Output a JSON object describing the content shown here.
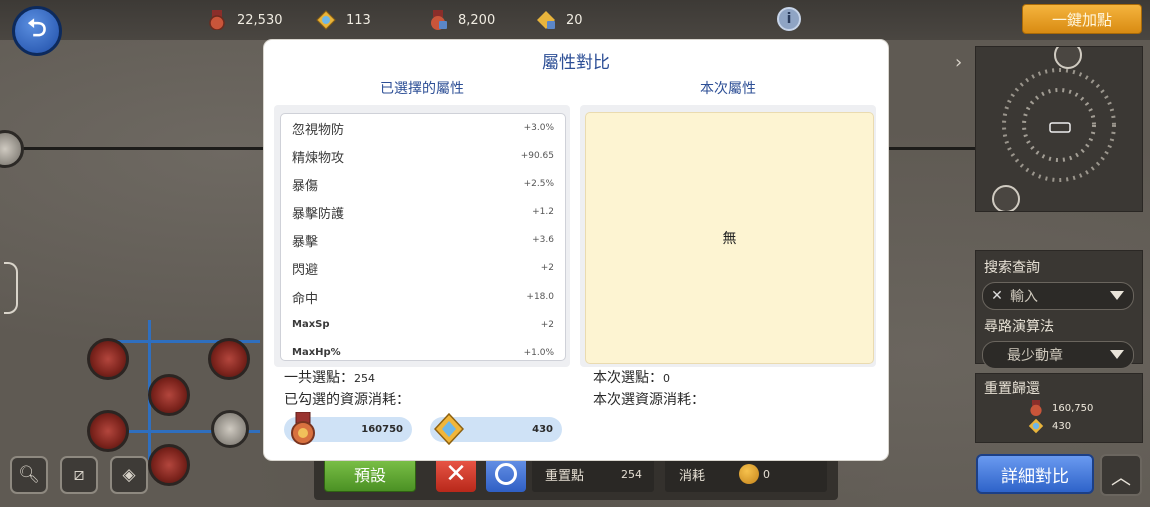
{
  "topbar": {
    "resources": [
      {
        "icon": "medal-icon",
        "value": "22,530"
      },
      {
        "icon": "crystal-icon",
        "value": "113"
      },
      {
        "icon": "locked-medal-icon",
        "value": "8,200"
      },
      {
        "icon": "locked-crystal-icon",
        "value": "20"
      }
    ],
    "info_label": "i",
    "auto_add_label": "一鍵加點"
  },
  "modal": {
    "title": "屬性對比",
    "selected_header": "已選擇的屬性",
    "current_header": "本次屬性",
    "attributes": [
      {
        "name": "忽視物防",
        "value": "+3.0%"
      },
      {
        "name": "精煉物攻",
        "value": "+90.65"
      },
      {
        "name": "暴傷",
        "value": "+2.5%"
      },
      {
        "name": "暴擊防護",
        "value": "+1.2"
      },
      {
        "name": "暴擊",
        "value": "+3.6"
      },
      {
        "name": "閃避",
        "value": "+2"
      },
      {
        "name": "命中",
        "value": "+18.0"
      },
      {
        "name": "MaxSp",
        "value": "+2"
      },
      {
        "name": "MaxHp%",
        "value": "+1.0%"
      }
    ],
    "current_empty": "無",
    "total_points_label": "一共選點：",
    "total_points_value": "254",
    "selected_cost_label": "已勾選的資源消耗：",
    "selected_cost": [
      {
        "icon": "medal-icon",
        "value": "160750"
      },
      {
        "icon": "crystal-icon",
        "value": "430"
      }
    ],
    "this_points_label": "本次選點：",
    "this_points_value": "0",
    "this_cost_label": "本次選資源消耗："
  },
  "side": {
    "search_label": "搜索查詢",
    "search_placeholder": "輸入",
    "path_label": "尋路演算法",
    "path_value": "最少動章",
    "reset_label": "重置歸還",
    "reset_items": [
      {
        "icon": "medal-icon",
        "value": "160,750"
      },
      {
        "icon": "crystal-icon",
        "value": "430"
      }
    ],
    "detail_compare_label": "詳細對比"
  },
  "bottombar": {
    "preset_label": "預設",
    "reset_points_label": "重置點",
    "reset_points_value": "254",
    "consume_label": "消耗",
    "consume_value": "0"
  },
  "colors": {
    "accent_blue": "#2d4f96",
    "gold_button": "#e9a22a",
    "green_button": "#62a834",
    "red_button": "#d7402f",
    "blue_button": "#3f6fd3",
    "empty_panel": "#fdf4d2",
    "pill_bg": "#cfe2f6"
  }
}
